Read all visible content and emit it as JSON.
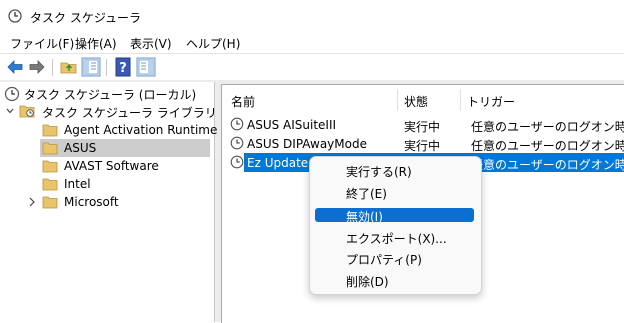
{
  "window": {
    "title": "タスク スケジューラ"
  },
  "menu": [
    "ファイル(F)",
    "操作(A)",
    "表示(V)",
    "ヘルプ(H)"
  ],
  "toolbar": {
    "icons": [
      "back-arrow-icon",
      "forward-arrow-icon",
      "folder-up-icon",
      "show-hide-tree-icon",
      "help-icon",
      "show-hide-action-pane-icon"
    ]
  },
  "tree": {
    "root": "タスク スケジューラ (ローカル)",
    "library": "タスク スケジューラ ライブラリ",
    "folders": [
      "Agent Activation Runtime",
      "ASUS",
      "AVAST Software",
      "Intel",
      "Microsoft"
    ],
    "selected": "ASUS"
  },
  "table": {
    "columns": [
      "名前",
      "状態",
      "トリガー"
    ],
    "rows": [
      {
        "name": "ASUS AISuiteIII",
        "status": "実行中",
        "trigger": "任意のユーザーのログオン時"
      },
      {
        "name": "ASUS DIPAwayMode",
        "status": "実行中",
        "trigger": "任意のユーザーのログオン時"
      },
      {
        "name": "Ez Update",
        "status": "",
        "trigger": "任意のユーザーのログオン時"
      }
    ],
    "selected_row": "Ez Update"
  },
  "context_menu": {
    "items": [
      "実行する(R)",
      "終了(E)",
      "無効(I)",
      "エクスポート(X)...",
      "プロパティ(P)",
      "削除(D)"
    ],
    "highlighted": "無効(I)"
  },
  "colors": {
    "selection": "#0078d7",
    "menu_highlight": "#0a6fd1",
    "folder": "#e8c46a"
  }
}
